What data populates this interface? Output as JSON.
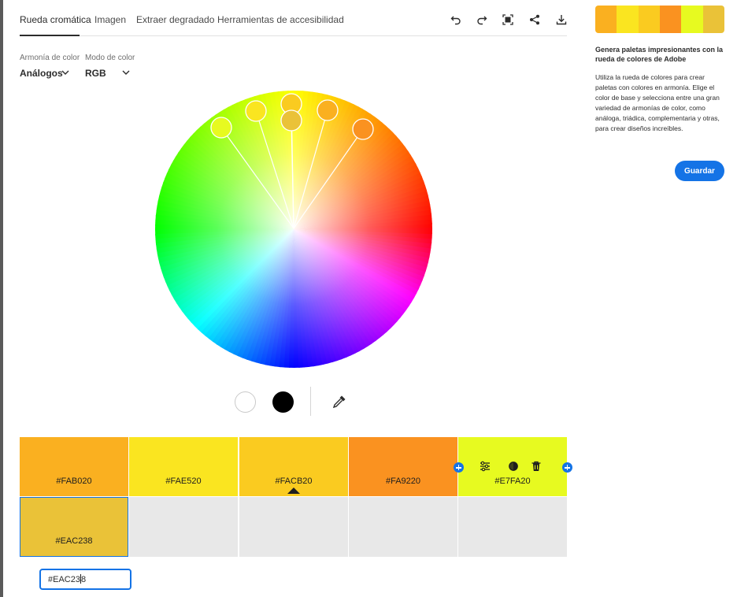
{
  "tabs": [
    {
      "label": "Rueda cromática"
    },
    {
      "label": "Imagen"
    },
    {
      "label": "Extraer degradado"
    },
    {
      "label": "Herramientas de accesibilidad"
    }
  ],
  "toolbar": {
    "icons": [
      "undo-icon",
      "redo-icon",
      "fit-screen-icon",
      "share-icon",
      "download-icon"
    ]
  },
  "harmony": {
    "label": "Armonía de color",
    "value": "Análogos"
  },
  "mode": {
    "label": "Modo de color",
    "value": "RGB"
  },
  "palette": {
    "swatches": [
      {
        "hex": "#FAB020",
        "color": "#FAB020"
      },
      {
        "hex": "#FAE520",
        "color": "#FAE520"
      },
      {
        "hex": "#FACB20",
        "color": "#FACB20"
      },
      {
        "hex": "#FA9220",
        "color": "#FA9220"
      },
      {
        "hex": "#E7FA20",
        "color": "#E7FA20"
      },
      {
        "hex": "#EAC238",
        "color": "#EAC238"
      }
    ],
    "selected_hex_input": "#EAC238"
  },
  "bottom_controls": {
    "light_swatch": "#ffffff",
    "dark_swatch": "#000000",
    "icons": [
      "white-swatch-icon",
      "black-swatch-icon",
      "eyedropper-icon"
    ]
  },
  "cell_actions": [
    "adjust-sliders-icon",
    "contrast-icon",
    "trash-icon"
  ],
  "sidebar": {
    "title": "Genera paletas impresionantes con la rueda de colores de Adobe",
    "description": "Utiliza la rueda de colores para crear paletas con colores en armonía. Elige el color de base y selecciona entre una gran variedad de armonías de color, como análoga, triádica, complementaria y otras, para crear diseños increíbles.",
    "save_label": "Guardar"
  },
  "colors": {
    "accent": "#1473e6",
    "swatch_strip": [
      "#FAB020",
      "#FAE520",
      "#FACB20",
      "#FA9220",
      "#E7FA20",
      "#EAC238"
    ]
  }
}
